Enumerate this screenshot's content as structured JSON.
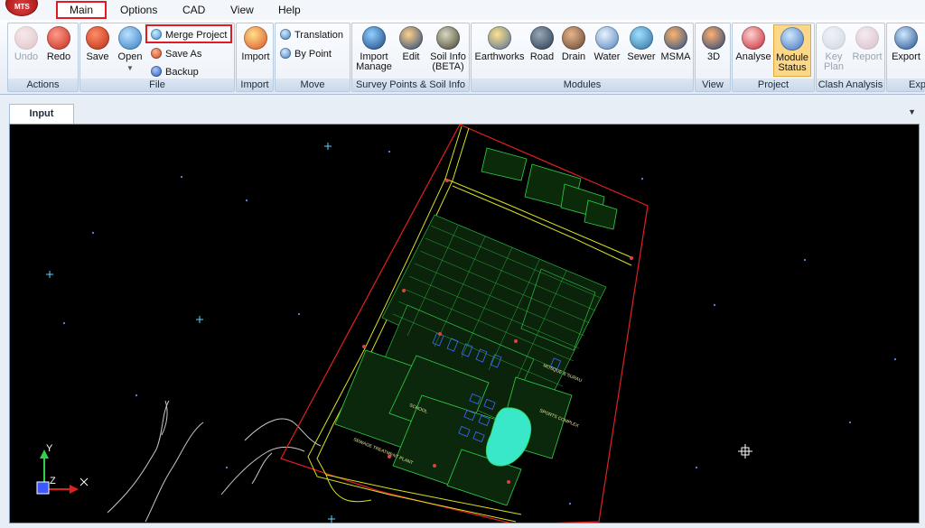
{
  "app": {
    "logo_text": "MTS"
  },
  "menu": [
    "Main",
    "Options",
    "CAD",
    "View",
    "Help"
  ],
  "ribbon": {
    "actions": {
      "label": "Actions",
      "undo": "Undo",
      "redo": "Redo"
    },
    "file": {
      "label": "File",
      "save": "Save",
      "open": "Open",
      "merge_project": "Merge Project",
      "save_as": "Save As",
      "backup": "Backup"
    },
    "import": {
      "label": "Import",
      "import": "Import"
    },
    "move": {
      "label": "Move",
      "translation": "Translation",
      "by_point": "By Point"
    },
    "survey": {
      "label": "Survey Points & Soil Info",
      "import_manage_1": "Import",
      "import_manage_2": "Manage",
      "edit": "Edit",
      "soil_info_1": "Soil Info",
      "soil_info_2": "(BETA)"
    },
    "modules": {
      "label": "Modules",
      "items": [
        "Earthworks",
        "Road",
        "Drain",
        "Water",
        "Sewer",
        "MSMA"
      ]
    },
    "view": {
      "label": "View",
      "three_d": "3D"
    },
    "project": {
      "label": "Project",
      "analyse": "Analyse",
      "module_status_1": "Module",
      "module_status_2": "Status"
    },
    "clash": {
      "label": "Clash Analysis",
      "key_plan_1": "Key",
      "key_plan_2": "Plan",
      "report": "Report"
    },
    "export": {
      "label": "Exp",
      "export": "Export"
    }
  },
  "tabs": {
    "input": "Input"
  },
  "canvas": {
    "axis_y": "Y",
    "axis_z": "Z",
    "areas": [
      "MOSQUE & SURAU",
      "SPORTS COMPLEX",
      "SCHOOL",
      "SEWAGE TREATMENT PLANT"
    ]
  },
  "colors": {
    "menu_highlight": "#e01b24",
    "ribbon_group_label": "#c9d8ea",
    "module_status_active": "#fbd78a",
    "cad_background": "#000000",
    "site_boundary": "#e02020",
    "road_lines": "#d8e020",
    "lot_lines": "#2fd24a",
    "pond_fill": "#38e8c8",
    "crosshair": "#5ad8ff"
  },
  "icons": [
    "undo-icon",
    "redo-icon",
    "save-icon",
    "open-icon",
    "merge-project-icon",
    "save-as-icon",
    "backup-icon",
    "import-icon",
    "translation-icon",
    "by-point-icon",
    "import-manage-icon",
    "edit-icon",
    "soil-info-icon",
    "earthworks-icon",
    "road-icon",
    "drain-icon",
    "water-icon",
    "sewer-icon",
    "msma-icon",
    "3d-icon",
    "analyse-icon",
    "module-status-icon",
    "key-plan-icon",
    "report-icon",
    "export-icon"
  ]
}
